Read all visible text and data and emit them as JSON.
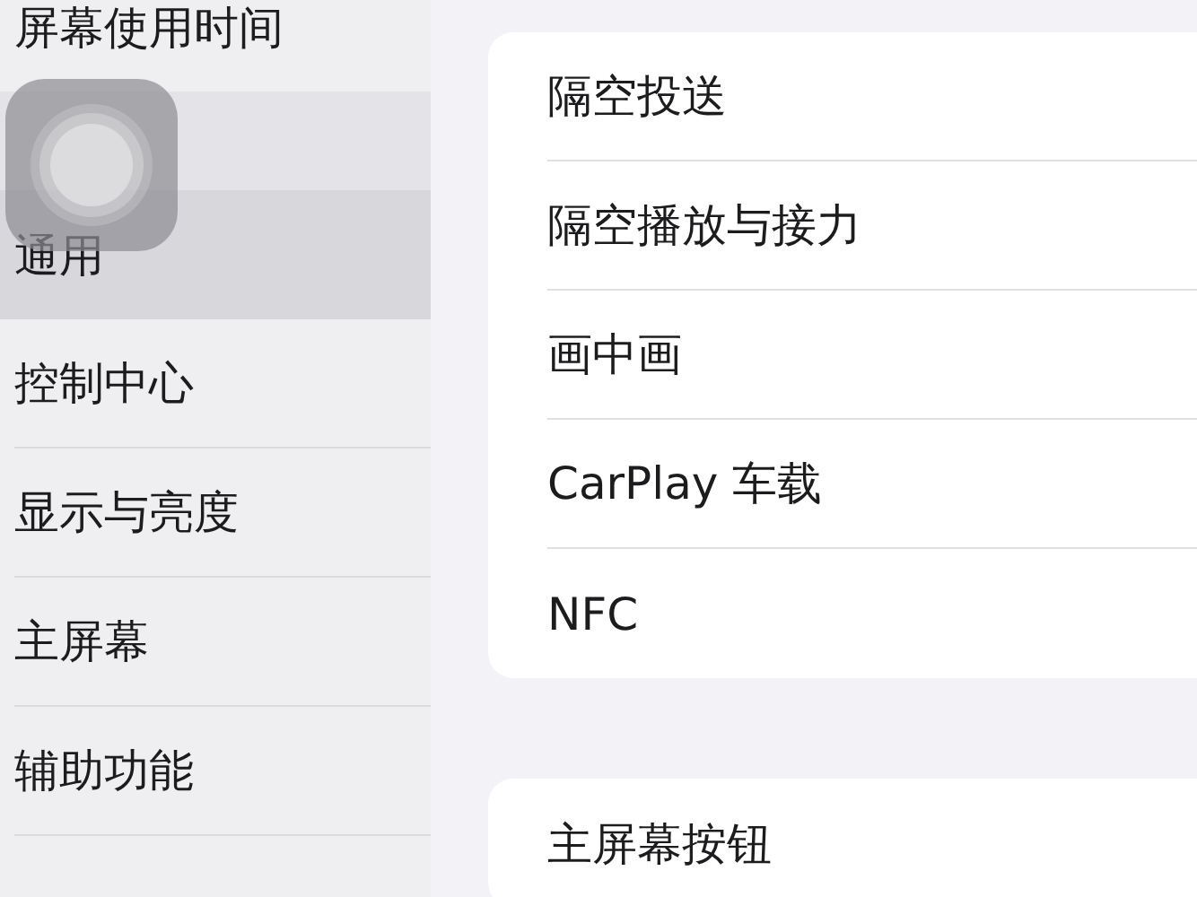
{
  "sidebar": {
    "items": [
      {
        "label": "屏幕使用时间",
        "kind": "item",
        "selected": false
      },
      {
        "kind": "spacer"
      },
      {
        "label": "通用",
        "kind": "item",
        "selected": true
      },
      {
        "label": "控制中心",
        "kind": "item",
        "selected": false
      },
      {
        "label": "显示与亮度",
        "kind": "item",
        "selected": false
      },
      {
        "label": "主屏幕",
        "kind": "item",
        "selected": false
      },
      {
        "label": "辅助功能",
        "kind": "item",
        "selected": false
      }
    ]
  },
  "groups": [
    {
      "rows": [
        "隔空投送",
        "隔空播放与接力",
        "画中画",
        "CarPlay 车载",
        "NFC"
      ]
    },
    {
      "rows": [
        "主屏幕按钮"
      ]
    }
  ],
  "assistive_touch": {
    "visible": true
  }
}
